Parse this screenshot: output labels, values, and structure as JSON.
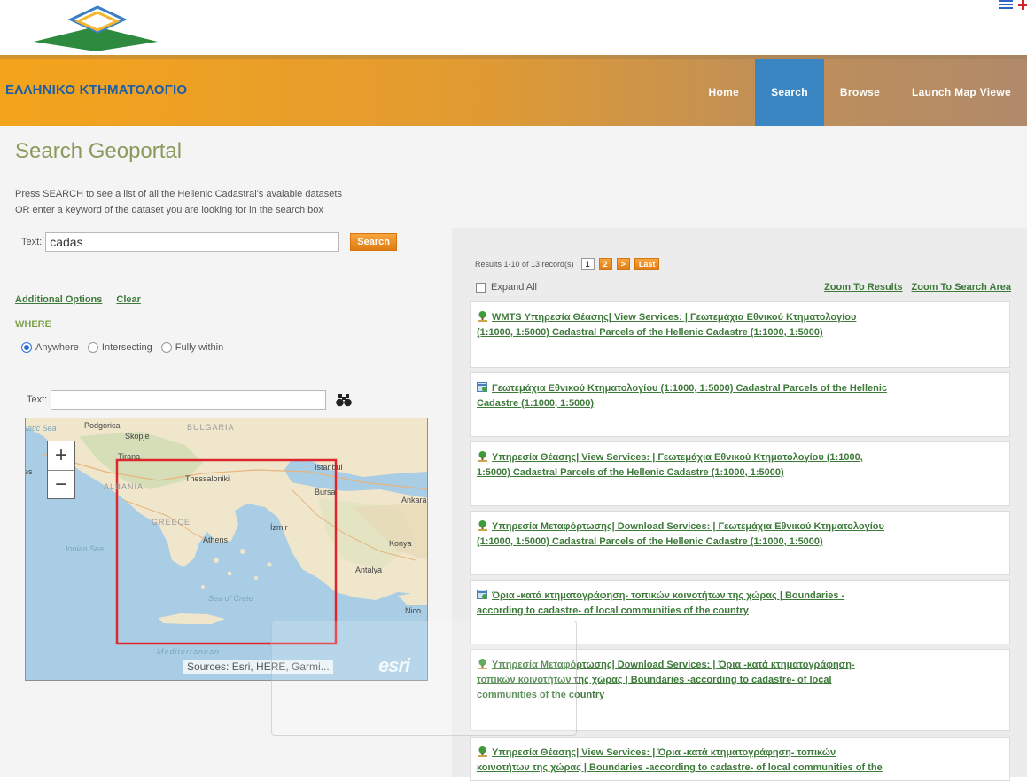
{
  "header": {
    "brand": "ΕΛΛΗΝΙΚΟ ΚΤΗΜΑΤΟΛΟΓΙΟ",
    "nav": [
      "Home",
      "Search",
      "Browse",
      "Launch Map Viewe"
    ],
    "active_nav": "Search"
  },
  "search": {
    "title": "Search Geoportal",
    "intro_line1": "Press SEARCH to see a list of all the Hellenic Cadastral's avaiable datasets",
    "intro_line2": "OR enter a keyword of the dataset you are looking for in the search box",
    "text_label": "Text:",
    "query": "cadas",
    "button": "Search"
  },
  "options": {
    "additional": "Additional Options",
    "clear": "Clear",
    "where": "WHERE",
    "radios": [
      "Anywhere",
      "Intersecting",
      "Fully within"
    ],
    "selected_radio": "Anywhere"
  },
  "map": {
    "text_label": "Text:",
    "text_value": "",
    "zoom_in": "+",
    "zoom_out": "−",
    "labels": {
      "podgorica": "Podgorica",
      "skopje": "Skopje",
      "bulgaria": "BULGARIA",
      "tirana": "Tirana",
      "albania": "ALBANIA",
      "thessaloniki": "Thessaloniki",
      "istanbul": "Istanbul",
      "bursa": "Bursa",
      "ankara": "Ankara",
      "greece": "GREECE",
      "izmir": "İzmir",
      "athens": "Athens",
      "konya": "Konya",
      "antalya": "Antalya",
      "ionian_sea": "Ionian Sea",
      "sea_of_crete": "Sea of Crete",
      "nicosia": "Nico",
      "mediterranean": "Mediterranean",
      "adriatic": "iatic Sea",
      "es": "es"
    },
    "attribution": "Sources: Esri, HERE, Garmi...",
    "esri_logo": "esri"
  },
  "results": {
    "summary": "Results 1-10 of 13 record(s)",
    "pages": [
      "1",
      "2",
      ">",
      "Last"
    ],
    "current_page": "1",
    "expand_all": "Expand All",
    "zoom_to_results": "Zoom To Results",
    "zoom_to_search_area": "Zoom To Search Area",
    "items": [
      {
        "icon": "service-tree-icon",
        "line1": "WMTS Υπηρεσία Θέασης| View Services: | Γεωτεμάχια Εθνικού Κτηματολογίου",
        "line2": "(1:1000, 1:5000) Cadastral Parcels of the Hellenic Cadastre (1:1000, 1:5000)",
        "line3": ""
      },
      {
        "icon": "dataset-icon",
        "line1": "Γεωτεμάχια Εθνικού Κτηματολογίου (1:1000, 1:5000) Cadastral Parcels of the Hellenic",
        "line2": "Cadastre (1:1000, 1:5000)",
        "line3": ""
      },
      {
        "icon": "service-tree-icon",
        "line1": "Υπηρεσία Θέασης| View Services: | Γεωτεμάχια Εθνικού Κτηματολογίου (1:1000,",
        "line2": "1:5000) Cadastral Parcels of the Hellenic Cadastre (1:1000, 1:5000)",
        "line3": ""
      },
      {
        "icon": "service-tree-icon",
        "line1": "Υπηρεσία Μεταφόρτωσης| Download Services: | Γεωτεμάχια Εθνικού Κτηματολογίου",
        "line2": "(1:1000, 1:5000) Cadastral Parcels of the Hellenic Cadastre (1:1000, 1:5000)",
        "line3": ""
      },
      {
        "icon": "dataset-icon",
        "line1": "Όρια -κατά κτηματογράφηση- τοπικών κοινοτήτων της χώρας | Boundaries -",
        "line2": "according to cadastre- of local communities of the country",
        "line3": ""
      },
      {
        "icon": "service-tree-icon",
        "line1": "Υπηρεσία Μεταφόρτωσης| Download Services: | Όρια -κατά κτηματογράφηση-",
        "line2": "τοπικών κοινοτήτων της χώρας | Boundaries -according to cadastre- of local",
        "line3": "communities of the country"
      },
      {
        "icon": "service-tree-icon",
        "line1": "Υπηρεσία Θέασης| View Services: | Όρια -κατά κτηματογράφηση- τοπικών",
        "line2": "κοινοτήτων της χώρας | Boundaries -according to cadastre- of local communities of the",
        "line3": ""
      }
    ]
  },
  "colors": {
    "brand_text": "#1b5da8",
    "nav_active": "#3a86c3",
    "link_green": "#3e7a3a",
    "title_olive": "#8a9a5b",
    "search_area_box": "#e0262d"
  }
}
